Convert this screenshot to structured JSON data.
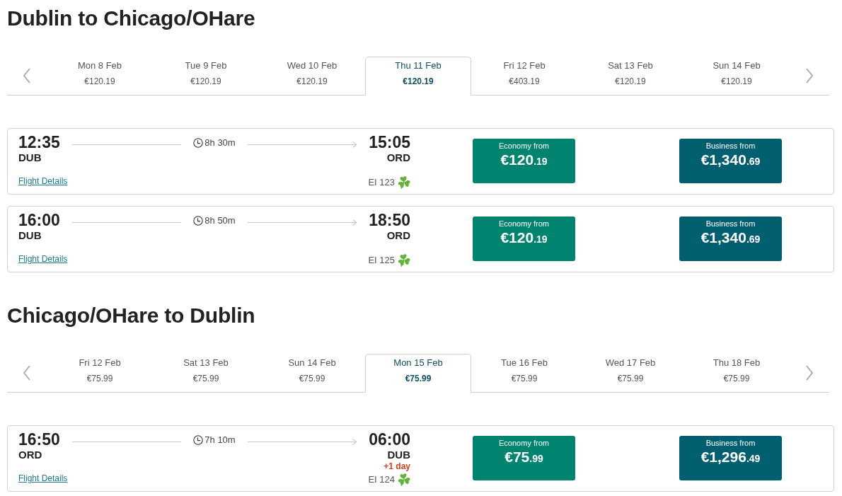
{
  "journeys": [
    {
      "title": "Dublin to Chicago/OHare",
      "dates": [
        {
          "day": "Mon 8 Feb",
          "price": "€120.19",
          "selected": false
        },
        {
          "day": "Tue 9 Feb",
          "price": "€120.19",
          "selected": false
        },
        {
          "day": "Wed 10 Feb",
          "price": "€120.19",
          "selected": false
        },
        {
          "day": "Thu 11 Feb",
          "price": "€120.19",
          "selected": true
        },
        {
          "day": "Fri 12 Feb",
          "price": "€403.19",
          "selected": false
        },
        {
          "day": "Sat 13 Feb",
          "price": "€120.19",
          "selected": false
        },
        {
          "day": "Sun 14 Feb",
          "price": "€120.19",
          "selected": false
        }
      ],
      "flights": [
        {
          "depart_time": "12:35",
          "depart_airport": "DUB",
          "duration": "8h 30m",
          "arrive_time": "15:05",
          "arrive_airport": "ORD",
          "details_link": "Flight Details",
          "flight_number": "EI 123",
          "fares": [
            {
              "kind": "economy",
              "label": "Economy from",
              "amount": "€120",
              "cents": ".19"
            },
            {
              "kind": "business",
              "label": "Business from",
              "amount": "€1,340",
              "cents": ".69"
            }
          ]
        },
        {
          "depart_time": "16:00",
          "depart_airport": "DUB",
          "duration": "8h 50m",
          "arrive_time": "18:50",
          "arrive_airport": "ORD",
          "details_link": "Flight Details",
          "flight_number": "EI 125",
          "fares": [
            {
              "kind": "economy",
              "label": "Economy from",
              "amount": "€120",
              "cents": ".19"
            },
            {
              "kind": "business",
              "label": "Business from",
              "amount": "€1,340",
              "cents": ".69"
            }
          ]
        }
      ]
    },
    {
      "title": "Chicago/OHare to Dublin",
      "dates": [
        {
          "day": "Fri 12 Feb",
          "price": "€75.99",
          "selected": false
        },
        {
          "day": "Sat 13 Feb",
          "price": "€75.99",
          "selected": false
        },
        {
          "day": "Sun 14 Feb",
          "price": "€75.99",
          "selected": false
        },
        {
          "day": "Mon 15 Feb",
          "price": "€75.99",
          "selected": true
        },
        {
          "day": "Tue 16 Feb",
          "price": "€75.99",
          "selected": false
        },
        {
          "day": "Wed 17 Feb",
          "price": "€75.99",
          "selected": false
        },
        {
          "day": "Thu 18 Feb",
          "price": "€75.99",
          "selected": false
        }
      ],
      "flights": [
        {
          "depart_time": "16:50",
          "depart_airport": "ORD",
          "duration": "7h 10m",
          "arrive_time": "06:00",
          "arrive_airport": "DUB",
          "day_offset": "+1 day",
          "details_link": "Flight Details",
          "flight_number": "EI 124",
          "fares": [
            {
              "kind": "economy",
              "label": "Economy from",
              "amount": "€75",
              "cents": ".99"
            },
            {
              "kind": "business",
              "label": "Business from",
              "amount": "€1,296",
              "cents": ".49"
            }
          ]
        }
      ]
    }
  ]
}
